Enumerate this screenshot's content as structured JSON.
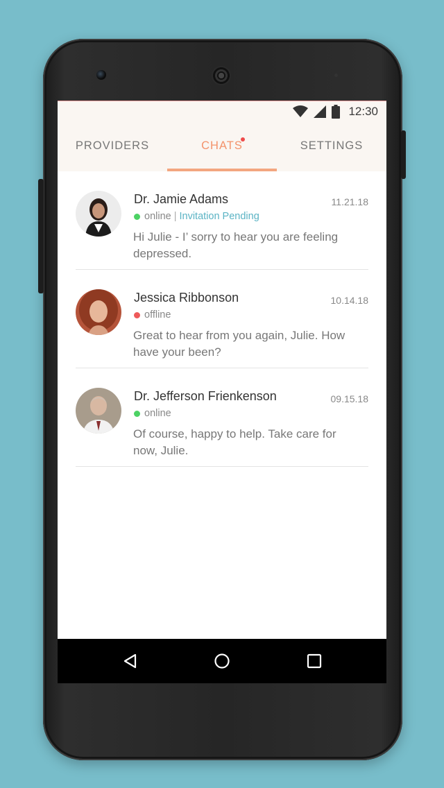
{
  "status_bar": {
    "time": "12:30"
  },
  "tabs": [
    {
      "label": "PROVIDERS",
      "active": false
    },
    {
      "label": "CHATS",
      "active": true,
      "has_notification": true
    },
    {
      "label": "SETTINGS",
      "active": false
    }
  ],
  "chats": [
    {
      "name": "Dr. Jamie Adams",
      "date": "11.21.18",
      "status": "online",
      "status_color": "#4cd264",
      "pending_label": "Invitation Pending",
      "message": "Hi Julie - I’ sorry to hear you are  feeling depressed."
    },
    {
      "name": "Jessica Ribbonson",
      "date": "10.14.18",
      "status": "offline",
      "status_color": "#ee5a5a",
      "message": "Great to hear from you again, Julie. How have your been?"
    },
    {
      "name": "Dr. Jefferson Frienkenson",
      "date": "09.15.18",
      "status": "online",
      "status_color": "#4cd264",
      "message": "Of course, happy to help. Take care for now, Julie."
    }
  ],
  "icons": {
    "status": [
      "wifi-icon",
      "signal-icon",
      "battery-icon"
    ],
    "nav": [
      "back-icon",
      "home-icon",
      "recents-icon"
    ]
  },
  "colors": {
    "background": "#78bdca",
    "accent": "#f3926b",
    "pending": "#5ab3c4"
  }
}
